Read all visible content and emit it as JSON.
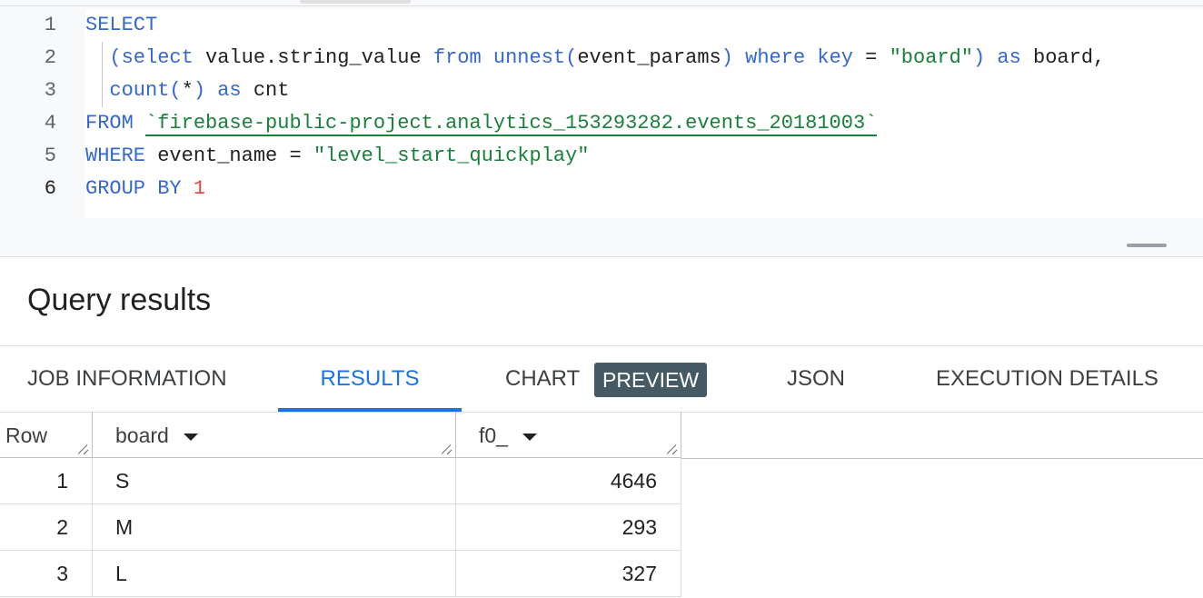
{
  "editor": {
    "line_numbers": [
      "1",
      "2",
      "3",
      "4",
      "5",
      "6"
    ],
    "code": {
      "l1": {
        "kw1": "SELECT"
      },
      "l2": {
        "p1": "(select",
        "t1": " value.string_value ",
        "p2": "from unnest(",
        "t2": "event_params",
        "p3": ") where key",
        "t3": " = ",
        "s1": "\"board\"",
        "p4": ") as",
        "t4": " board,"
      },
      "l3": {
        "p1": "count(",
        "t1": "*",
        "p2": ") as",
        "t2": " cnt"
      },
      "l4": {
        "kw1": "FROM",
        "sp": " ",
        "s1": "`firebase-public-project.analytics_153293282.events_20181003`"
      },
      "l5": {
        "kw1": "WHERE",
        "t1": " event_name = ",
        "s1": "\"level_start_quickplay\""
      },
      "l6": {
        "kw1": "GROUP BY",
        "sp": " ",
        "n1": "1"
      }
    }
  },
  "results": {
    "title": "Query results",
    "tabs": [
      {
        "label": "JOB INFORMATION"
      },
      {
        "label": "RESULTS"
      },
      {
        "label": "CHART",
        "badge": "PREVIEW"
      },
      {
        "label": "JSON"
      },
      {
        "label": "EXECUTION DETAILS"
      }
    ],
    "active_tab": "RESULTS",
    "table": {
      "headers": [
        "Row",
        "board",
        "f0_"
      ],
      "rows": [
        [
          "1",
          "S",
          "4646"
        ],
        [
          "2",
          "M",
          "293"
        ],
        [
          "3",
          "L",
          "327"
        ]
      ]
    }
  },
  "colors": {
    "keyword": "#3367d6",
    "string": "#188038",
    "number": "#e8453c",
    "active_tab": "#1a73e8",
    "badge_bg": "#455a64"
  }
}
